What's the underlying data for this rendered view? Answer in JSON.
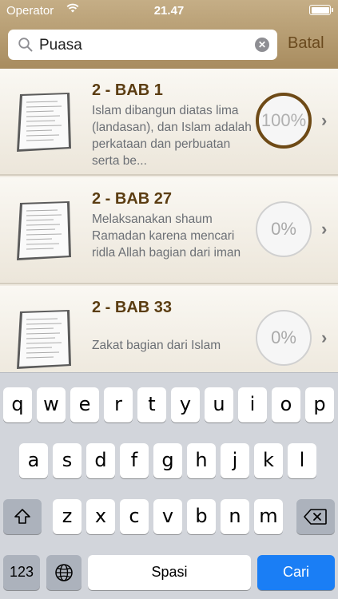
{
  "status": {
    "carrier": "Operator",
    "time": "21.47",
    "wifi_icon": "wifi-icon",
    "battery_icon": "battery-icon"
  },
  "search": {
    "query": "Puasa",
    "cancel_label": "Batal"
  },
  "results": [
    {
      "title": "2 - BAB 1",
      "description": "Islam dibangun diatas lima (landasan), dan Islam adalah perkataan dan perbuatan serta be...",
      "progress": "100%"
    },
    {
      "title": "2 - BAB 27",
      "description": "Melaksanakan shaum Ramadan karena mencari ridla Allah bagian dari iman",
      "progress": "0%"
    },
    {
      "title": "2 - BAB 33",
      "description": "Zakat bagian dari Islam",
      "progress": "0%"
    }
  ],
  "keyboard": {
    "row1": [
      "q",
      "w",
      "e",
      "r",
      "t",
      "y",
      "u",
      "i",
      "o",
      "p"
    ],
    "row2": [
      "a",
      "s",
      "d",
      "f",
      "g",
      "h",
      "j",
      "k",
      "l"
    ],
    "row3": [
      "z",
      "x",
      "c",
      "v",
      "b",
      "n",
      "m"
    ],
    "numbers_label": "123",
    "space_label": "Spasi",
    "return_label": "Cari"
  },
  "colors": {
    "accent": "#6e4a16",
    "title": "#5b3d12",
    "return_key": "#1a7ef5"
  }
}
